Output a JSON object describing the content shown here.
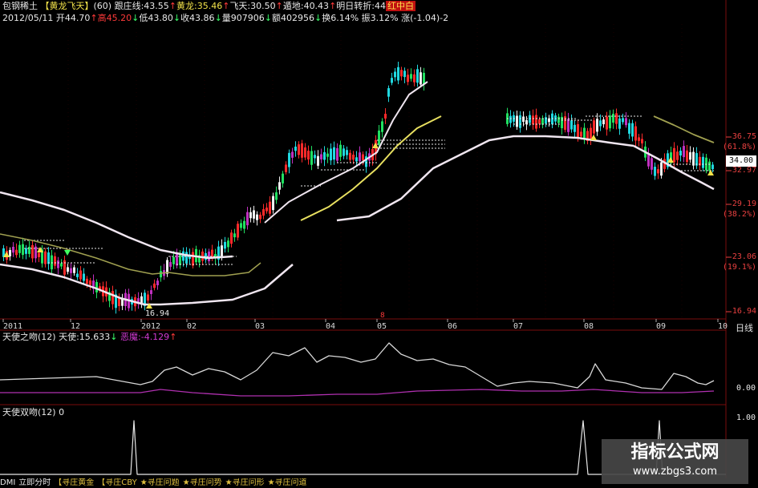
{
  "header": {
    "line1": [
      {
        "text": "包钢稀土",
        "color": "#e8e8e8"
      },
      {
        "text": " 【黄龙飞天】",
        "color": "#f2e24a"
      },
      {
        "text": "(60)",
        "color": "#e8e8e8"
      },
      {
        "text": " 跟庄线:43.55",
        "color": "#e8e8e8"
      },
      {
        "text": "↑",
        "color": "#ff3a3a"
      },
      {
        "text": "黄龙:35.46",
        "color": "#f2e24a"
      },
      {
        "text": "↑",
        "color": "#ff3a3a"
      },
      {
        "text": "飞天:30.50",
        "color": "#e8e8e8"
      },
      {
        "text": "↑",
        "color": "#ff3a3a"
      },
      {
        "text": "遁地:40.43",
        "color": "#e8e8e8"
      },
      {
        "text": "↑",
        "color": "#ff3a3a"
      },
      {
        "text": "明日转折:44",
        "color": "#e8e8e8"
      }
    ],
    "badge": "红中白",
    "line2": [
      {
        "text": "2012/05/11 ",
        "color": "#e8e8e8"
      },
      {
        "text": "开44.70",
        "color": "#e8e8e8"
      },
      {
        "text": "↑",
        "color": "#ff3a3a"
      },
      {
        "text": "高45.20",
        "color": "#ff3a3a"
      },
      {
        "text": "↓",
        "color": "#3aff6a"
      },
      {
        "text": "低43.80",
        "color": "#e8e8e8"
      },
      {
        "text": "↓",
        "color": "#3aff6a"
      },
      {
        "text": "收43.86",
        "color": "#e8e8e8"
      },
      {
        "text": "↓",
        "color": "#3aff6a"
      },
      {
        "text": "量907906",
        "color": "#e8e8e8"
      },
      {
        "text": "↓",
        "color": "#3aff6a"
      },
      {
        "text": "额402956",
        "color": "#e8e8e8"
      },
      {
        "text": "↓",
        "color": "#3aff6a"
      },
      {
        "text": "换6.14%",
        "color": "#e8e8e8"
      },
      {
        "text": " 振3.12%",
        "color": "#e8e8e8"
      },
      {
        "text": " 涨(-1.04)-2",
        "color": "#e8e8e8"
      }
    ]
  },
  "price_axis": {
    "ticks": [
      {
        "label": "36.75",
        "color": "#e84040",
        "value": 36.75
      },
      {
        "label": "(61.8%)",
        "color": "#e84040",
        "value": 35.6
      },
      {
        "label": "32.97",
        "color": "#e84040",
        "value": 32.97
      },
      {
        "label": "29.19",
        "color": "#e84040",
        "value": 29.19
      },
      {
        "label": "(38.2%)",
        "color": "#e84040",
        "value": 28.1
      },
      {
        "label": "23.06",
        "color": "#e84040",
        "value": 23.06
      },
      {
        "label": "(19.1%)",
        "color": "#e84040",
        "value": 21.6
      },
      {
        "label": "16.94",
        "color": "#e84040",
        "value": 16.94
      }
    ],
    "current_price": "34.00",
    "low_marker": "16.94"
  },
  "time_axis": {
    "labels": [
      "2011",
      "12",
      "2012",
      "02",
      "03",
      "04",
      "05",
      "06",
      "07",
      "08",
      "09",
      "10"
    ],
    "period_label": "日线"
  },
  "indicator1": {
    "title": "天使之吻(12)",
    "line_label": "天使:15.633",
    "line_arrow": "↓",
    "demon_label": "恶魔:-4.129",
    "demon_arrow": "↑",
    "axis": [
      "0.00"
    ]
  },
  "indicator2": {
    "title": "天使双吻(12) 0",
    "axis": [
      "1.00"
    ]
  },
  "tabs": [
    {
      "label": "DMI",
      "active": true
    },
    {
      "label": "立即分时",
      "active": true
    },
    {
      "label": "【寻庄黄金",
      "active": false
    },
    {
      "label": "【寻庄CBY",
      "active": false
    },
    {
      "label": "★寻庄问题",
      "active": false
    },
    {
      "label": "★寻庄问势",
      "active": false
    },
    {
      "label": "★寻庄问形",
      "active": false
    },
    {
      "label": "★寻庄问道",
      "active": false
    }
  ],
  "watermark": {
    "title": "指标公式网",
    "url": "www.zbgs3.com"
  },
  "colors": {
    "up": "#ff2a2a",
    "down": "#20d8e0",
    "green": "#20e060",
    "magenta": "#c030c0",
    "yellow_line": "#e8e060",
    "white_line": "#f0e6f0",
    "olive_line": "#a0a050",
    "grid_red": "#7a0c0c"
  }
}
